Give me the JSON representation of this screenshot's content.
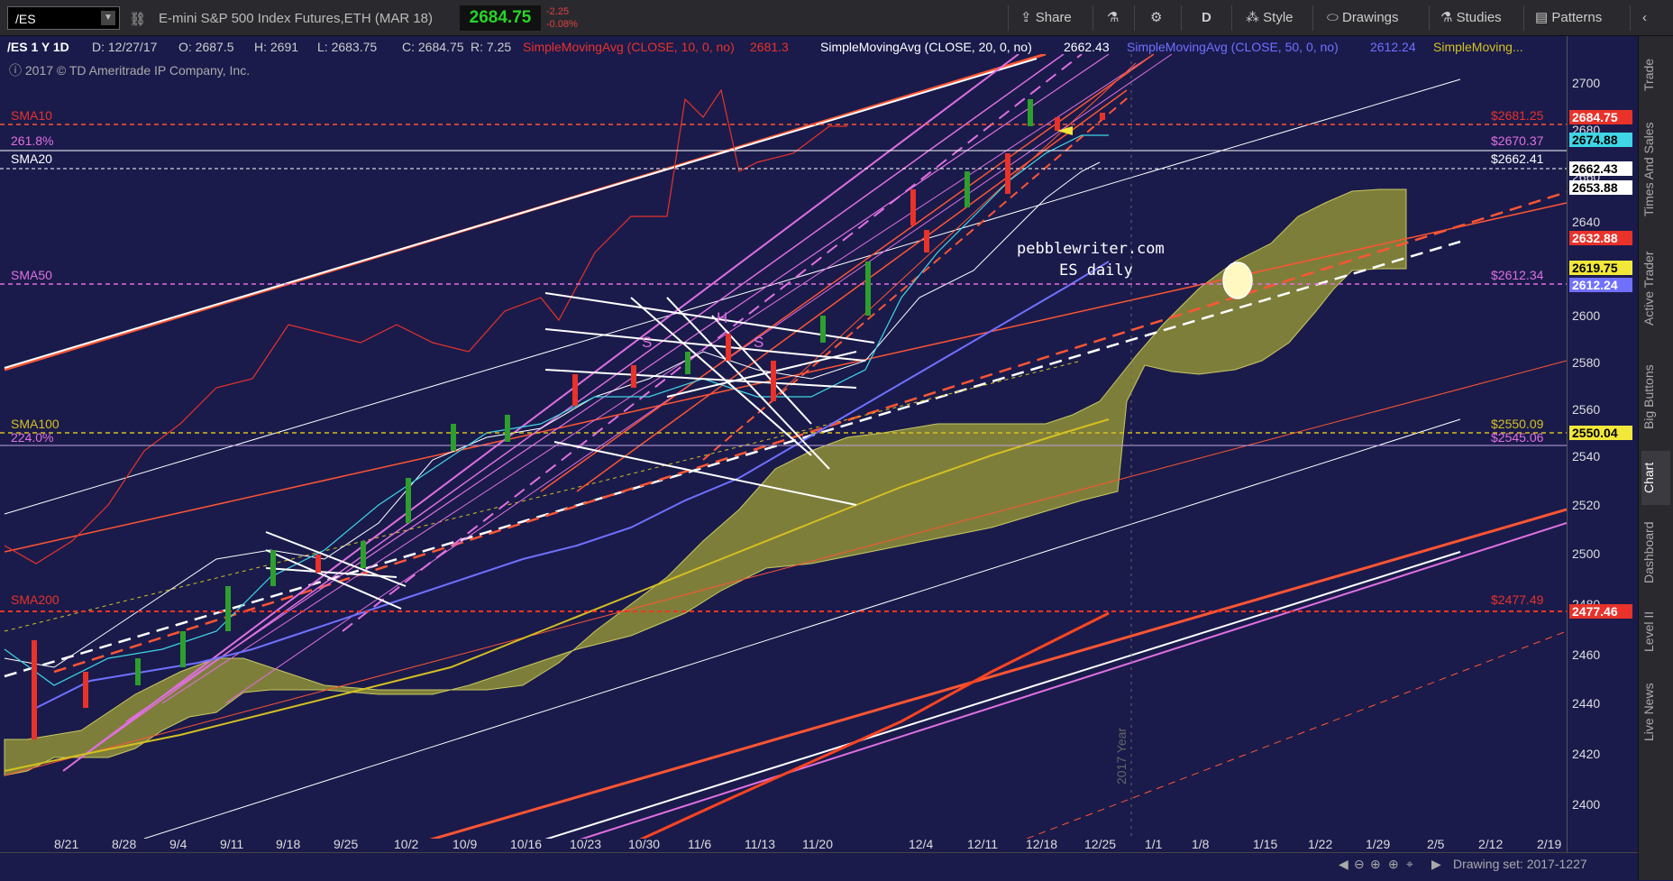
{
  "toolbar": {
    "symbol": "/ES",
    "description": "E-mini S&P 500 Index Futures,ETH (MAR 18)",
    "last_price": "2684.75",
    "change": "-2.25",
    "change_pct": "-0.08%",
    "share_label": "Share",
    "aggregation": "D",
    "style_label": "Style",
    "drawings_label": "Drawings",
    "studies_label": "Studies",
    "patterns_label": "Patterns"
  },
  "infobar": {
    "period": "/ES 1 Y 1D",
    "date": "D: 12/27/17",
    "open": "O: 2687.5",
    "high": "H: 2691",
    "low": "L: 2683.75",
    "close": "C: 2684.75",
    "range": "R: 7.25",
    "sma10_label": "SimpleMovingAvg (CLOSE, 10, 0, no)",
    "sma10_value": "2681.3",
    "sma20_label": "SimpleMovingAvg (CLOSE, 20, 0, no)",
    "sma20_value": "2662.43",
    "sma50_label": "SimpleMovingAvg (CLOSE, 50, 0, no)",
    "sma50_value": "2612.24",
    "sma_more": "SimpleMoving..."
  },
  "copyright": "2017 © TD Ameritrade IP Company, Inc.",
  "annotations": {
    "site": "pebblewriter.com",
    "subtitle": "ES daily",
    "s1": "S",
    "h": "H",
    "s2": "S",
    "year": "2017 Year"
  },
  "left_labels": {
    "sma10": "SMA10",
    "fib": "261.8%",
    "sma20": "SMA20",
    "sma50": "SMA50",
    "sma100": "SMA100",
    "fib224": "224.0%",
    "sma200": "SMA200"
  },
  "right_labels": {
    "sma10": "$2681.25",
    "fib": "$2670.37",
    "sma20": "$2662.41",
    "sma50": "$2612.34",
    "sma100": "$2550.09",
    "fib224": "$2545.06",
    "sma200": "$2477.49"
  },
  "y_ticks": [
    "2700",
    "2680",
    "2660",
    "2640",
    "2620",
    "2600",
    "2580",
    "2560",
    "2540",
    "2520",
    "2500",
    "2480",
    "2460",
    "2440",
    "2420",
    "2400"
  ],
  "y_badges": [
    {
      "text": "2684.75",
      "bg": "#e8322a",
      "fg": "#ffffff"
    },
    {
      "text": "2674.88",
      "bg": "#3fd6e6",
      "fg": "#000000"
    },
    {
      "text": "2662.43",
      "bg": "#ffffff",
      "fg": "#000000"
    },
    {
      "text": "2653.88",
      "bg": "#ffffff",
      "fg": "#000000"
    },
    {
      "text": "2632.88",
      "bg": "#e8322a",
      "fg": "#ffffff"
    },
    {
      "text": "2619.75",
      "bg": "#f2e83a",
      "fg": "#000000"
    },
    {
      "text": "2612.24",
      "bg": "#7070ff",
      "fg": "#ffffff"
    },
    {
      "text": "2550.04",
      "bg": "#f2e83a",
      "fg": "#000000"
    },
    {
      "text": "2477.46",
      "bg": "#e8322a",
      "fg": "#ffffff"
    }
  ],
  "x_ticks": [
    "8/21",
    "8/28",
    "9/4",
    "9/11",
    "9/18",
    "9/25",
    "10/2",
    "10/9",
    "10/16",
    "10/23",
    "10/30",
    "11/6",
    "11/13",
    "11/20",
    "12/4",
    "12/11",
    "12/18",
    "12/25",
    "1/1",
    "1/8",
    "1/15",
    "1/22",
    "1/29",
    "2/5",
    "2/12",
    "2/19"
  ],
  "right_tabs": [
    "Trade",
    "Times And Sales",
    "Active Trader",
    "Big Buttons",
    "Chart",
    "Dashboard",
    "Level II",
    "Live News"
  ],
  "drawing_set": "Drawing set: 2017-1227",
  "colors": {
    "background": "#1a1b4b",
    "up": "#2e9e2e",
    "down": "#e8322a",
    "sma10": "#e8322a",
    "sma20": "#ffffff",
    "sma50": "#7070ff",
    "sma_yellow": "#d4c020",
    "cloud": "#8a8a3a",
    "fan_pink": "#e070e0"
  }
}
